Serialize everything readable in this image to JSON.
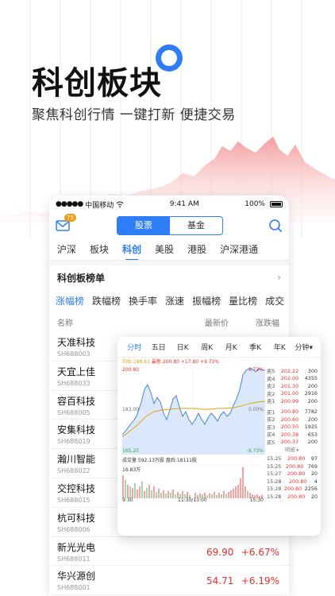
{
  "hero": {
    "title": "科创板块",
    "subtitle": "聚焦科创行情 一键打新 便捷交易"
  },
  "colors": {
    "accent": "#2f7df6",
    "up": "#e8302d",
    "avg": "#e0a000"
  },
  "status": {
    "carrier": "中国移动",
    "time": "9:41 AM",
    "battery": "100%"
  },
  "toolbar": {
    "badge": "75",
    "seg_stock": "股票",
    "seg_fund": "基金",
    "mail_icon": "mail-icon",
    "search_icon": "search-icon"
  },
  "market_tabs": [
    "沪深",
    "板块",
    "科创",
    "美股",
    "港股",
    "沪深港通"
  ],
  "list": {
    "title": "科创板榜单",
    "rank_tabs": [
      "涨幅榜",
      "跌幅榜",
      "换手率",
      "涨速",
      "振幅榜",
      "量比榜",
      "成交"
    ],
    "col_name": "名称",
    "col_price": "最新价",
    "col_change": "涨跌幅",
    "rows": [
      {
        "name": "天准科技",
        "code": "SH688003",
        "price": "",
        "change": ""
      },
      {
        "name": "天宜上佳",
        "code": "SH688033",
        "price": "",
        "change": ""
      },
      {
        "name": "容百科技",
        "code": "SH688005",
        "price": "",
        "change": ""
      },
      {
        "name": "安集科技",
        "code": "SH688019",
        "price": "",
        "change": ""
      },
      {
        "name": "瀚川智能",
        "code": "SH688022",
        "price": "",
        "change": ""
      },
      {
        "name": "交控科技",
        "code": "SH688015",
        "price": "",
        "change": ""
      },
      {
        "name": "杭可科技",
        "code": "SH688006",
        "price": "",
        "change": ""
      },
      {
        "name": "新光光电",
        "code": "SH688011",
        "price": "69.90",
        "change": "+6.67%"
      },
      {
        "name": "华兴源创",
        "code": "SH688001",
        "price": "54.71",
        "change": "+6.19%"
      }
    ]
  },
  "panel": {
    "tabs": [
      "分时",
      "五日",
      "日K",
      "周K",
      "月K",
      "季K",
      "年K",
      "分钟▾"
    ],
    "avg_line": "均价:188.61",
    "latest_line": "最新:200.80 +17.80 +9.73%",
    "labels": {
      "top_price": "200.80",
      "top_pct": "9.73%",
      "mid_price": "183.00",
      "mid_pct": "0.00%",
      "bot_price": "165.20",
      "bot_pct": "-9.73%",
      "volume": "成交量 592.13万股 盘后:18111股",
      "vol_max": "16.83万",
      "t0": "9:30",
      "t1": "11:30/13:00",
      "t2": "15:30"
    },
    "asks": [
      {
        "label": "卖5",
        "price": "202.22",
        "vol": "300"
      },
      {
        "label": "卖4",
        "price": "202.00",
        "vol": "4355"
      },
      {
        "label": "卖3",
        "price": "201.30",
        "vol": "200"
      },
      {
        "label": "卖2",
        "price": "201.00",
        "vol": "2916"
      },
      {
        "label": "卖1",
        "price": "200.99",
        "vol": "200"
      }
    ],
    "bids": [
      {
        "label": "买1",
        "price": "200.80",
        "vol": "7782"
      },
      {
        "label": "买2",
        "price": "200.60",
        "vol": "200"
      },
      {
        "label": "买3",
        "price": "200.50",
        "vol": "1925"
      },
      {
        "label": "买4",
        "price": "200.38",
        "vol": "653"
      },
      {
        "label": "买5",
        "price": "200.37",
        "vol": "200"
      }
    ],
    "detail_label": "明细 ▸",
    "ticks": [
      {
        "time": "15:25",
        "price": "200.80",
        "vol": "97"
      },
      {
        "time": "15:25",
        "price": "200.80",
        "vol": "769"
      },
      {
        "time": "15:27",
        "price": "200.80",
        "vol": "20"
      },
      {
        "time": "15:28",
        "price": "200.80",
        "vol": "4"
      },
      {
        "time": "15:28",
        "price": "200.80",
        "vol": "2256"
      },
      {
        "time": "15:28",
        "price": "200.80",
        "vol": "20"
      }
    ]
  }
}
